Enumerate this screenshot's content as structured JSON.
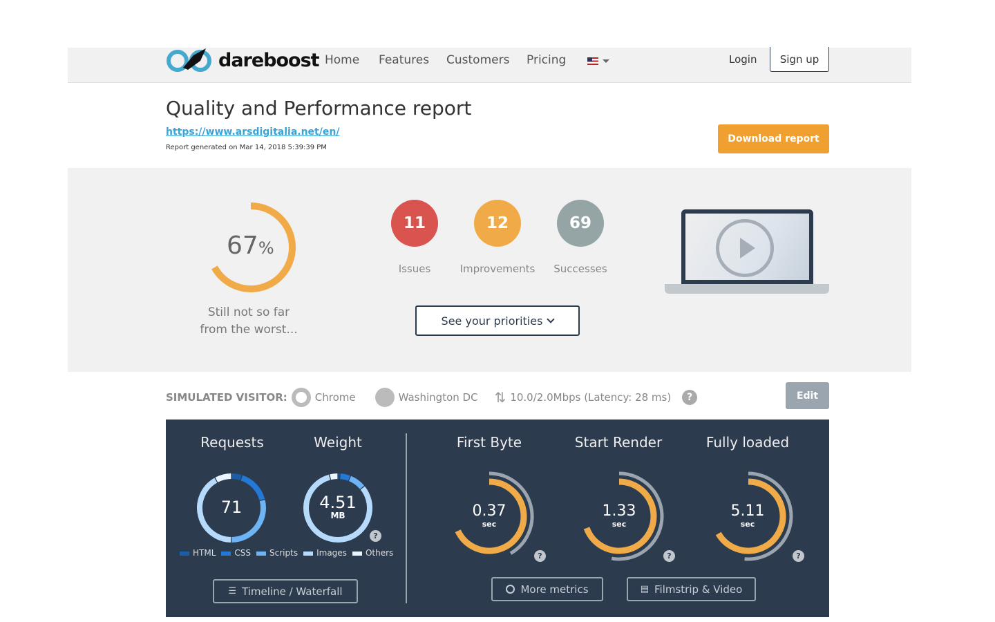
{
  "nav": {
    "brand": "dareboost",
    "links": [
      "Home",
      "Features",
      "Customers",
      "Pricing"
    ],
    "language_icon": "us-flag-icon",
    "login": "Login",
    "signup": "Sign up"
  },
  "report": {
    "title": "Quality and Performance report",
    "url": "https://www.arsdigitalia.net/en/",
    "generated": "Report generated on Mar 14, 2018 5:39:39 PM",
    "download": "Download report"
  },
  "score": {
    "value": "67",
    "unit": "%",
    "percent": 67,
    "message_line1": "Still not so far",
    "message_line2": "from the worst...",
    "color": "#f0ab48"
  },
  "counts": [
    {
      "value": "11",
      "label": "Issues",
      "color": "#d9534f"
    },
    {
      "value": "12",
      "label": "Improvements",
      "color": "#f0ab48"
    },
    {
      "value": "69",
      "label": "Successes",
      "color": "#95a5a6"
    }
  ],
  "priorities_button": "See your priorities",
  "visitor": {
    "label": "SIMULATED VISITOR:",
    "browser": "Chrome",
    "location": "Washington DC",
    "connection": "10.0/2.0Mbps (Latency: 28 ms)",
    "edit": "Edit"
  },
  "metrics": {
    "requests": {
      "title": "Requests",
      "value": "71",
      "shares": [
        5,
        16,
        29,
        42,
        8
      ]
    },
    "weight": {
      "title": "Weight",
      "value": "4.51",
      "unit": "MB",
      "shares": [
        1,
        5,
        8,
        82,
        4
      ]
    },
    "legend": [
      {
        "label": "HTML",
        "color": "#1b5ea8"
      },
      {
        "label": "CSS",
        "color": "#2279d6"
      },
      {
        "label": "Scripts",
        "color": "#6cb4f5"
      },
      {
        "label": "Images",
        "color": "#b5dafb"
      },
      {
        "label": "Others",
        "color": "#eaf5ff"
      }
    ],
    "timings": [
      {
        "title": "First Byte",
        "value": "0.37",
        "unit": "sec"
      },
      {
        "title": "Start Render",
        "value": "1.33",
        "unit": "sec"
      },
      {
        "title": "Fully loaded",
        "value": "5.11",
        "unit": "sec"
      }
    ],
    "buttons": {
      "timeline": "Timeline / Waterfall",
      "more": "More metrics",
      "filmstrip": "Filmstrip & Video"
    }
  }
}
